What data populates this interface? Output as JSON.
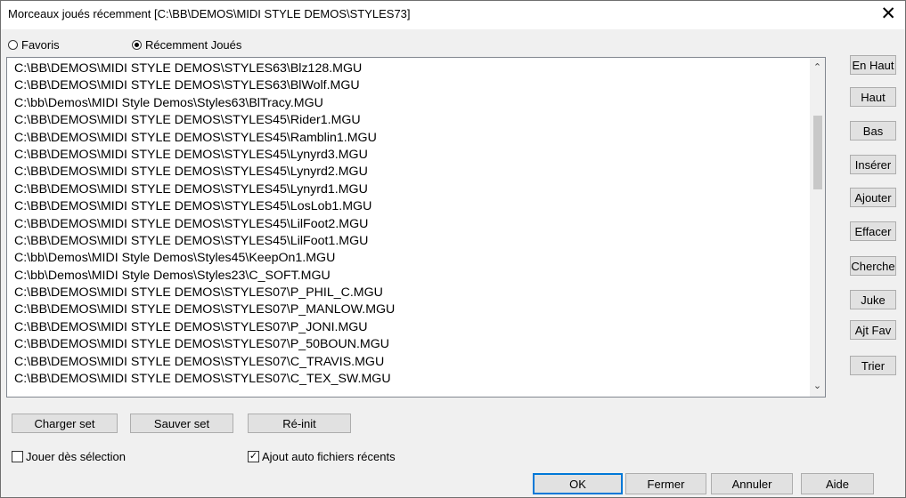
{
  "window": {
    "title": "Morceaux joués récemment   [C:\\BB\\DEMOS\\MIDI STYLE DEMOS\\STYLES73]",
    "close_glyph": "✕"
  },
  "mode": {
    "favoris_label": "Favoris",
    "recent_label": "Récemment Joués",
    "selected": "recent"
  },
  "files": [
    "C:\\BB\\DEMOS\\MIDI STYLE DEMOS\\STYLES63\\Blz128.MGU",
    "C:\\BB\\DEMOS\\MIDI STYLE DEMOS\\STYLES63\\BlWolf.MGU",
    "C:\\bb\\Demos\\MIDI Style Demos\\Styles63\\BlTracy.MGU",
    "C:\\BB\\DEMOS\\MIDI STYLE DEMOS\\STYLES45\\Rider1.MGU",
    "C:\\BB\\DEMOS\\MIDI STYLE DEMOS\\STYLES45\\Ramblin1.MGU",
    "C:\\BB\\DEMOS\\MIDI STYLE DEMOS\\STYLES45\\Lynyrd3.MGU",
    "C:\\BB\\DEMOS\\MIDI STYLE DEMOS\\STYLES45\\Lynyrd2.MGU",
    "C:\\BB\\DEMOS\\MIDI STYLE DEMOS\\STYLES45\\Lynyrd1.MGU",
    "C:\\BB\\DEMOS\\MIDI STYLE DEMOS\\STYLES45\\LosLob1.MGU",
    "C:\\BB\\DEMOS\\MIDI STYLE DEMOS\\STYLES45\\LilFoot2.MGU",
    "C:\\BB\\DEMOS\\MIDI STYLE DEMOS\\STYLES45\\LilFoot1.MGU",
    "C:\\bb\\Demos\\MIDI Style Demos\\Styles45\\KeepOn1.MGU",
    "C:\\bb\\Demos\\MIDI Style Demos\\Styles23\\C_SOFT.MGU",
    "C:\\BB\\DEMOS\\MIDI STYLE DEMOS\\STYLES07\\P_PHIL_C.MGU",
    "C:\\BB\\DEMOS\\MIDI STYLE DEMOS\\STYLES07\\P_MANLOW.MGU",
    "C:\\BB\\DEMOS\\MIDI STYLE DEMOS\\STYLES07\\P_JONI.MGU",
    "C:\\BB\\DEMOS\\MIDI STYLE DEMOS\\STYLES07\\P_50BOUN.MGU",
    "C:\\BB\\DEMOS\\MIDI STYLE DEMOS\\STYLES07\\C_TRAVIS.MGU",
    "C:\\BB\\DEMOS\\MIDI STYLE DEMOS\\STYLES07\\C_TEX_SW.MGU"
  ],
  "side_buttons": [
    "En Haut",
    "Haut",
    "Bas",
    "Insérer",
    "Ajouter",
    "Effacer",
    "Cherche",
    "Juke",
    "Ajt Fav",
    "Trier"
  ],
  "set_buttons": {
    "load": "Charger set",
    "save": "Sauver set",
    "reset": "Ré-init"
  },
  "options": {
    "play_on_select_label": "Jouer dès sélection",
    "play_on_select_checked": false,
    "auto_add_recent_label": "Ajout auto fichiers récents",
    "auto_add_recent_checked": true
  },
  "footer": {
    "ok": "OK",
    "close": "Fermer",
    "cancel": "Annuler",
    "help": "Aide"
  },
  "scrollbar": {
    "up_glyph": "⌃",
    "down_glyph": "⌄"
  }
}
